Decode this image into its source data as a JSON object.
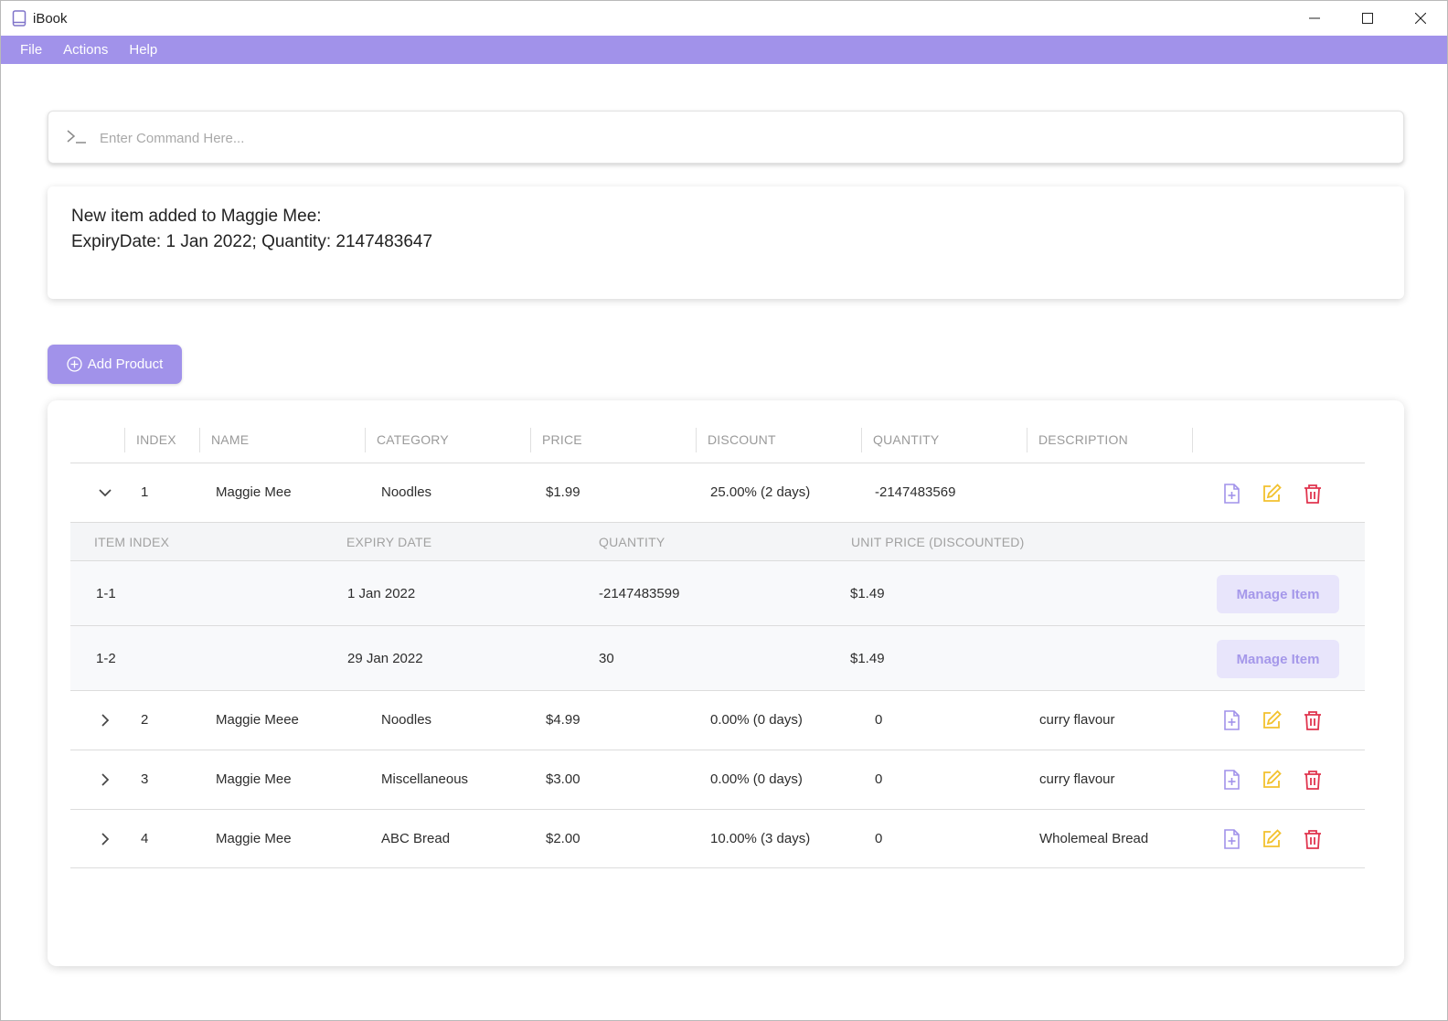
{
  "window": {
    "title": "iBook",
    "icon": "book-icon"
  },
  "menu": {
    "items": [
      "File",
      "Actions",
      "Help"
    ]
  },
  "command": {
    "placeholder": "Enter Command Here...",
    "value": "",
    "icon": "terminal-prompt-icon"
  },
  "result": {
    "line1": "New item added to Maggie Mee:",
    "line2": "ExpiryDate: 1 Jan 2022; Quantity: 2147483647"
  },
  "add_button": {
    "label": "Add Product",
    "icon": "plus-circle-icon"
  },
  "table": {
    "columns": [
      "INDEX",
      "NAME",
      "CATEGORY",
      "PRICE",
      "DISCOUNT",
      "QUANTITY",
      "DESCRIPTION"
    ],
    "products": [
      {
        "index": "1",
        "name": "Maggie Mee",
        "category": "Noodles",
        "price": "$1.99",
        "discount": "25.00% (2 days)",
        "quantity": "-2147483569",
        "description": "",
        "expanded": true
      },
      {
        "index": "2",
        "name": "Maggie Meee",
        "category": "Noodles",
        "price": "$4.99",
        "discount": "0.00% (0 days)",
        "quantity": "0",
        "description": "curry flavour",
        "expanded": false
      },
      {
        "index": "3",
        "name": "Maggie Mee",
        "category": "Miscellaneous",
        "price": "$3.00",
        "discount": "0.00% (0 days)",
        "quantity": "0",
        "description": "curry flavour",
        "expanded": false
      },
      {
        "index": "4",
        "name": "Maggie Mee",
        "category": "ABC Bread",
        "price": "$2.00",
        "discount": "10.00% (3 days)",
        "quantity": "0",
        "description": "Wholemeal Bread",
        "expanded": false
      }
    ],
    "item_columns": [
      "ITEM INDEX",
      "EXPIRY DATE",
      "QUANTITY",
      "UNIT PRICE (DISCOUNTED)"
    ],
    "items": [
      {
        "index": "1-1",
        "expiry": "1 Jan 2022",
        "quantity": "-2147483599",
        "unit_price": "$1.49",
        "action": "Manage Item"
      },
      {
        "index": "1-2",
        "expiry": "29 Jan 2022",
        "quantity": "30",
        "unit_price": "$1.49",
        "action": "Manage Item"
      }
    ]
  },
  "colors": {
    "accent": "#a192ea",
    "add_item": "#a192ea",
    "edit": "#f2c12e",
    "delete": "#e0344e"
  }
}
